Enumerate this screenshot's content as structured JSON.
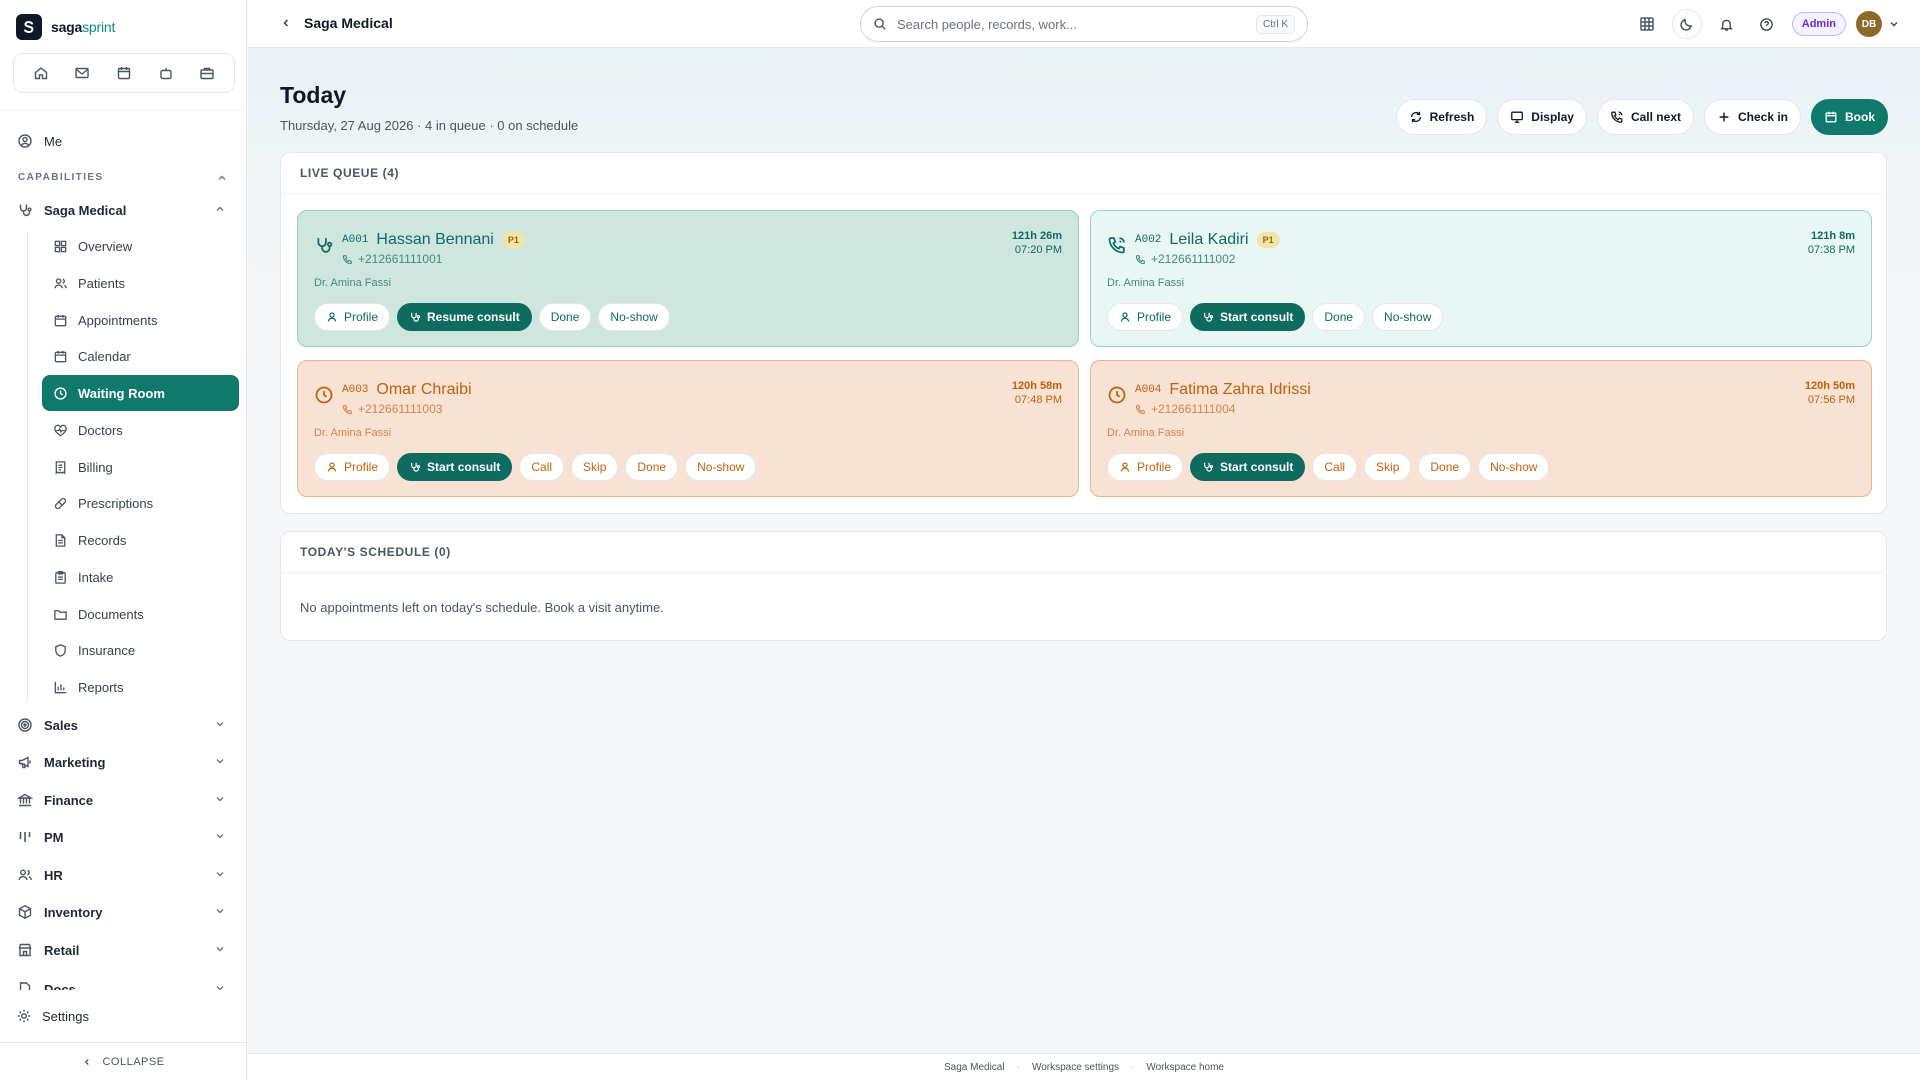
{
  "brand": {
    "name_a": "saga",
    "name_b": "sprint"
  },
  "sidebar": {
    "me": "Me",
    "capabilities_label": "CAPABILITIES",
    "section": "Saga Medical",
    "sub_items": [
      {
        "label": "Overview"
      },
      {
        "label": "Patients"
      },
      {
        "label": "Appointments"
      },
      {
        "label": "Calendar"
      },
      {
        "label": "Waiting Room"
      },
      {
        "label": "Doctors"
      },
      {
        "label": "Billing"
      },
      {
        "label": "Prescriptions"
      },
      {
        "label": "Records"
      },
      {
        "label": "Intake"
      },
      {
        "label": "Documents"
      },
      {
        "label": "Insurance"
      },
      {
        "label": "Reports"
      }
    ],
    "groups": [
      {
        "label": "Sales"
      },
      {
        "label": "Marketing"
      },
      {
        "label": "Finance"
      },
      {
        "label": "PM"
      },
      {
        "label": "HR"
      },
      {
        "label": "Inventory"
      },
      {
        "label": "Retail"
      },
      {
        "label": "Docs"
      }
    ],
    "settings": "Settings",
    "collapse": "COLLAPSE"
  },
  "topbar": {
    "breadcrumb": "Saga Medical",
    "search_placeholder": "Search people, records, work...",
    "search_shortcut": "Ctrl K",
    "role_badge": "Admin",
    "avatar_initials": "DB"
  },
  "page": {
    "title": "Today",
    "subtitle": "Thursday, 27 Aug 2026 · 4 in queue · 0 on schedule",
    "actions": {
      "refresh": "Refresh",
      "display": "Display",
      "call_next": "Call next",
      "check_in": "Check in",
      "book": "Book"
    }
  },
  "live_queue": {
    "heading": "LIVE QUEUE (4)",
    "items": [
      {
        "code": "A001",
        "name": "Hassan Bennani",
        "priority": "P1",
        "phone": "+212661111001",
        "doctor": "Dr. Amina Fassi",
        "elapsed": "121h 26m",
        "time": "07:20 PM",
        "buttons": {
          "profile": "Profile",
          "consult": "Resume consult",
          "done": "Done",
          "no_show": "No-show"
        }
      },
      {
        "code": "A002",
        "name": "Leila Kadiri",
        "priority": "P1",
        "phone": "+212661111002",
        "doctor": "Dr. Amina Fassi",
        "elapsed": "121h 8m",
        "time": "07:38 PM",
        "buttons": {
          "profile": "Profile",
          "consult": "Start consult",
          "done": "Done",
          "no_show": "No-show"
        }
      },
      {
        "code": "A003",
        "name": "Omar Chraibi",
        "phone": "+212661111003",
        "doctor": "Dr. Amina Fassi",
        "elapsed": "120h 58m",
        "time": "07:48 PM",
        "buttons": {
          "profile": "Profile",
          "consult": "Start consult",
          "call": "Call",
          "skip": "Skip",
          "done": "Done",
          "no_show": "No-show"
        }
      },
      {
        "code": "A004",
        "name": "Fatima Zahra Idrissi",
        "phone": "+212661111004",
        "doctor": "Dr. Amina Fassi",
        "elapsed": "120h 50m",
        "time": "07:56 PM",
        "buttons": {
          "profile": "Profile",
          "consult": "Start consult",
          "call": "Call",
          "skip": "Skip",
          "done": "Done",
          "no_show": "No-show"
        }
      }
    ]
  },
  "schedule": {
    "heading": "TODAY'S SCHEDULE (0)",
    "empty": "No appointments left on today's schedule. Book a visit anytime."
  },
  "footer": {
    "link1": "Saga Medical",
    "link2": "Workspace settings",
    "link3": "Workspace home",
    "separator": "·"
  },
  "colors": {
    "accent": "#0f7a6b",
    "queue_green": "#cfe6df",
    "queue_mint": "#e9f7f4",
    "queue_peach": "#f7e2d4",
    "warning": "#c2610c"
  }
}
